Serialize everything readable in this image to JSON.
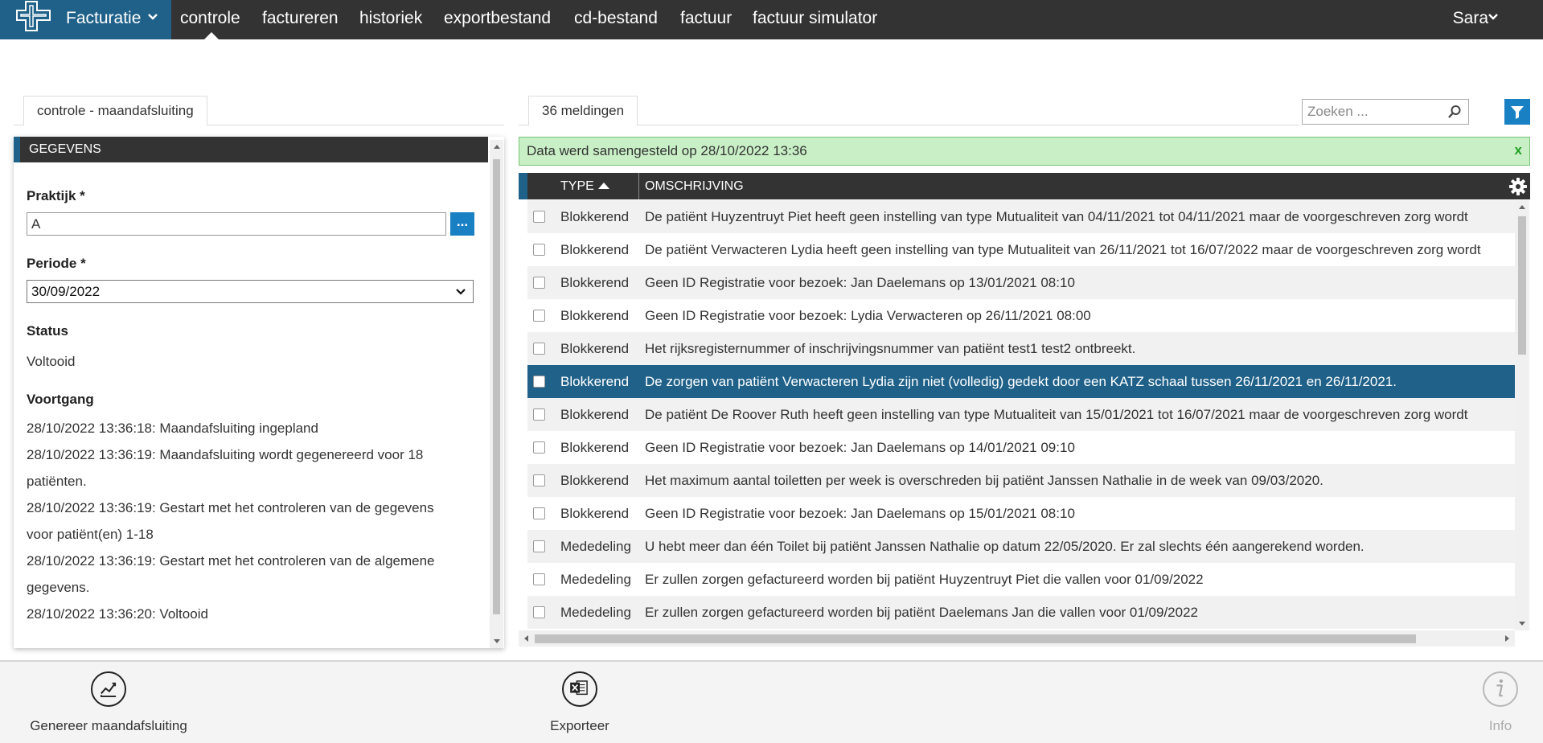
{
  "topbar": {
    "brand": "Facturatie",
    "nav": [
      {
        "label": "controle"
      },
      {
        "label": "factureren"
      },
      {
        "label": "historiek"
      },
      {
        "label": "exportbestand"
      },
      {
        "label": "cd-bestand"
      },
      {
        "label": "factuur"
      },
      {
        "label": "factuur simulator"
      }
    ],
    "user": "Sara"
  },
  "left_tab": "controle - maandafsluiting",
  "right_tab": "36 meldingen",
  "search": {
    "placeholder": "Zoeken ..."
  },
  "form": {
    "section_title": "GEGEVENS",
    "praktijk_label": "Praktijk *",
    "praktijk_value": "A",
    "praktijk_button": "...",
    "periode_label": "Periode *",
    "periode_value": "30/09/2022",
    "status_label": "Status",
    "status_value": "Voltooid",
    "voortgang_label": "Voortgang",
    "voortgang_lines": [
      "28/10/2022 13:36:18: Maandafsluiting ingepland",
      "28/10/2022 13:36:19: Maandafsluiting wordt gegenereerd voor 18",
      "patiënten.",
      "28/10/2022 13:36:19: Gestart met het controleren van de gegevens",
      "voor patiënt(en) 1-18",
      "28/10/2022 13:36:19: Gestart met het controleren van de algemene",
      "gegevens.",
      "28/10/2022 13:36:20: Voltooid"
    ]
  },
  "banner": {
    "text": "Data werd samengesteld op 28/10/2022 13:36",
    "close": "x"
  },
  "table": {
    "columns": {
      "type": "TYPE",
      "description": "OMSCHRIJVING"
    },
    "sort_column": "TYPE",
    "sort_direction": "asc",
    "selected_row": 5,
    "rows": [
      {
        "type": "Blokkerend",
        "description": "De patiënt Huyzentruyt Piet heeft geen instelling van type Mutualiteit van 04/11/2021 tot 04/11/2021 maar de voorgeschreven zorg wordt"
      },
      {
        "type": "Blokkerend",
        "description": "De patiënt Verwacteren Lydia heeft geen instelling van type Mutualiteit van 26/11/2021 tot 16/07/2022 maar de voorgeschreven zorg wordt"
      },
      {
        "type": "Blokkerend",
        "description": "Geen ID Registratie voor bezoek: Jan Daelemans op 13/01/2021 08:10"
      },
      {
        "type": "Blokkerend",
        "description": "Geen ID Registratie voor bezoek: Lydia Verwacteren op 26/11/2021 08:00"
      },
      {
        "type": "Blokkerend",
        "description": "Het rijksregisternummer of inschrijvingsnummer van patiënt test1 test2 ontbreekt."
      },
      {
        "type": "Blokkerend",
        "description": "De zorgen van patiënt Verwacteren Lydia zijn niet (volledig) gedekt door een KATZ schaal tussen 26/11/2021 en 26/11/2021."
      },
      {
        "type": "Blokkerend",
        "description": "De patiënt De Roover Ruth heeft geen instelling van type Mutualiteit van 15/01/2021 tot 16/07/2021 maar de voorgeschreven zorg wordt"
      },
      {
        "type": "Blokkerend",
        "description": "Geen ID Registratie voor bezoek: Jan Daelemans op 14/01/2021 09:10"
      },
      {
        "type": "Blokkerend",
        "description": "Het maximum aantal toiletten per week is overschreden bij patiënt Janssen Nathalie in de week van 09/03/2020."
      },
      {
        "type": "Blokkerend",
        "description": "Geen ID Registratie voor bezoek: Jan Daelemans op 15/01/2021 08:10"
      },
      {
        "type": "Mededeling",
        "description": "U hebt meer dan één Toilet bij patiënt Janssen Nathalie op datum 22/05/2020. Er zal slechts één aangerekend worden."
      },
      {
        "type": "Mededeling",
        "description": "Er zullen zorgen gefactureerd worden bij patiënt Huyzentruyt Piet die vallen voor 01/09/2022"
      },
      {
        "type": "Mededeling",
        "description": "Er zullen zorgen gefactureerd worden bij patiënt Daelemans Jan die vallen voor 01/09/2022"
      }
    ]
  },
  "actions": [
    {
      "label": "Genereer maandafsluiting",
      "icon": "chart-icon"
    },
    {
      "label": "Exporteer",
      "icon": "excel-icon"
    },
    {
      "label": "Info",
      "icon": "info-icon"
    }
  ],
  "colors": {
    "brand_blue": "#1f6189",
    "button_blue": "#1a80c4",
    "topbar_dark": "#333333",
    "banner_green": "#c9efc6",
    "selected_row": "#1f6189"
  }
}
